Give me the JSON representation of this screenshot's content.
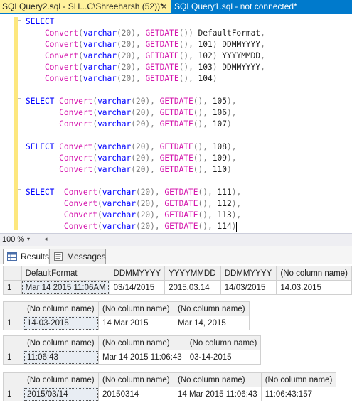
{
  "tabs": {
    "active_label": "SQLQuery2.sql - SH...C\\Shreeharsh (52))*",
    "close_glyph": "×",
    "inactive_label": "SQLQuery1.sql - not connected*"
  },
  "editor": {
    "lines": [
      [
        {
          "t": "SELECT",
          "c": "kw"
        }
      ],
      [
        {
          "t": "    ",
          "c": "bk"
        },
        {
          "t": "Convert",
          "c": "fn"
        },
        {
          "t": "(",
          "c": "gy"
        },
        {
          "t": "varchar",
          "c": "kw"
        },
        {
          "t": "(20), ",
          "c": "gy"
        },
        {
          "t": "GETDATE",
          "c": "fn"
        },
        {
          "t": "()) ",
          "c": "gy"
        },
        {
          "t": "DefaultFormat",
          "c": "bk"
        },
        {
          "t": ",",
          "c": "gy"
        }
      ],
      [
        {
          "t": "    ",
          "c": "bk"
        },
        {
          "t": "Convert",
          "c": "fn"
        },
        {
          "t": "(",
          "c": "gy"
        },
        {
          "t": "varchar",
          "c": "kw"
        },
        {
          "t": "(20), ",
          "c": "gy"
        },
        {
          "t": "GETDATE",
          "c": "fn"
        },
        {
          "t": "(), ",
          "c": "gy"
        },
        {
          "t": "101",
          "c": "bk"
        },
        {
          "t": ") ",
          "c": "gy"
        },
        {
          "t": "DDMMYYYY",
          "c": "bk"
        },
        {
          "t": ",",
          "c": "gy"
        }
      ],
      [
        {
          "t": "    ",
          "c": "bk"
        },
        {
          "t": "Convert",
          "c": "fn"
        },
        {
          "t": "(",
          "c": "gy"
        },
        {
          "t": "varchar",
          "c": "kw"
        },
        {
          "t": "(20), ",
          "c": "gy"
        },
        {
          "t": "GETDATE",
          "c": "fn"
        },
        {
          "t": "(), ",
          "c": "gy"
        },
        {
          "t": "102",
          "c": "bk"
        },
        {
          "t": ") ",
          "c": "gy"
        },
        {
          "t": "YYYYMMDD",
          "c": "bk"
        },
        {
          "t": ",",
          "c": "gy"
        }
      ],
      [
        {
          "t": "    ",
          "c": "bk"
        },
        {
          "t": "Convert",
          "c": "fn"
        },
        {
          "t": "(",
          "c": "gy"
        },
        {
          "t": "varchar",
          "c": "kw"
        },
        {
          "t": "(20), ",
          "c": "gy"
        },
        {
          "t": "GETDATE",
          "c": "fn"
        },
        {
          "t": "(), ",
          "c": "gy"
        },
        {
          "t": "103",
          "c": "bk"
        },
        {
          "t": ") ",
          "c": "gy"
        },
        {
          "t": "DDMMYYYY",
          "c": "bk"
        },
        {
          "t": ",",
          "c": "gy"
        }
      ],
      [
        {
          "t": "    ",
          "c": "bk"
        },
        {
          "t": "Convert",
          "c": "fn"
        },
        {
          "t": "(",
          "c": "gy"
        },
        {
          "t": "varchar",
          "c": "kw"
        },
        {
          "t": "(20), ",
          "c": "gy"
        },
        {
          "t": "GETDATE",
          "c": "fn"
        },
        {
          "t": "(), ",
          "c": "gy"
        },
        {
          "t": "104",
          "c": "bk"
        },
        {
          "t": ")",
          "c": "gy"
        }
      ],
      [],
      [
        {
          "t": "SELECT ",
          "c": "kw"
        },
        {
          "t": "Convert",
          "c": "fn"
        },
        {
          "t": "(",
          "c": "gy"
        },
        {
          "t": "varchar",
          "c": "kw"
        },
        {
          "t": "(20), ",
          "c": "gy"
        },
        {
          "t": "GETDATE",
          "c": "fn"
        },
        {
          "t": "(), ",
          "c": "gy"
        },
        {
          "t": "105",
          "c": "bk"
        },
        {
          "t": "),",
          "c": "gy"
        }
      ],
      [
        {
          "t": "       ",
          "c": "bk"
        },
        {
          "t": "Convert",
          "c": "fn"
        },
        {
          "t": "(",
          "c": "gy"
        },
        {
          "t": "varchar",
          "c": "kw"
        },
        {
          "t": "(20), ",
          "c": "gy"
        },
        {
          "t": "GETDATE",
          "c": "fn"
        },
        {
          "t": "(), ",
          "c": "gy"
        },
        {
          "t": "106",
          "c": "bk"
        },
        {
          "t": "),",
          "c": "gy"
        }
      ],
      [
        {
          "t": "       ",
          "c": "bk"
        },
        {
          "t": "Convert",
          "c": "fn"
        },
        {
          "t": "(",
          "c": "gy"
        },
        {
          "t": "varchar",
          "c": "kw"
        },
        {
          "t": "(20), ",
          "c": "gy"
        },
        {
          "t": "GETDATE",
          "c": "fn"
        },
        {
          "t": "(), ",
          "c": "gy"
        },
        {
          "t": "107",
          "c": "bk"
        },
        {
          "t": ")",
          "c": "gy"
        }
      ],
      [],
      [
        {
          "t": "SELECT ",
          "c": "kw"
        },
        {
          "t": "Convert",
          "c": "fn"
        },
        {
          "t": "(",
          "c": "gy"
        },
        {
          "t": "varchar",
          "c": "kw"
        },
        {
          "t": "(20), ",
          "c": "gy"
        },
        {
          "t": "GETDATE",
          "c": "fn"
        },
        {
          "t": "(), ",
          "c": "gy"
        },
        {
          "t": "108",
          "c": "bk"
        },
        {
          "t": "),",
          "c": "gy"
        }
      ],
      [
        {
          "t": "       ",
          "c": "bk"
        },
        {
          "t": "Convert",
          "c": "fn"
        },
        {
          "t": "(",
          "c": "gy"
        },
        {
          "t": "varchar",
          "c": "kw"
        },
        {
          "t": "(20), ",
          "c": "gy"
        },
        {
          "t": "GETDATE",
          "c": "fn"
        },
        {
          "t": "(), ",
          "c": "gy"
        },
        {
          "t": "109",
          "c": "bk"
        },
        {
          "t": "),",
          "c": "gy"
        }
      ],
      [
        {
          "t": "       ",
          "c": "bk"
        },
        {
          "t": "Convert",
          "c": "fn"
        },
        {
          "t": "(",
          "c": "gy"
        },
        {
          "t": "varchar",
          "c": "kw"
        },
        {
          "t": "(20), ",
          "c": "gy"
        },
        {
          "t": "GETDATE",
          "c": "fn"
        },
        {
          "t": "(), ",
          "c": "gy"
        },
        {
          "t": "110",
          "c": "bk"
        },
        {
          "t": ")",
          "c": "gy"
        }
      ],
      [],
      [
        {
          "t": "SELECT  ",
          "c": "kw"
        },
        {
          "t": "Convert",
          "c": "fn"
        },
        {
          "t": "(",
          "c": "gy"
        },
        {
          "t": "varchar",
          "c": "kw"
        },
        {
          "t": "(20), ",
          "c": "gy"
        },
        {
          "t": "GETDATE",
          "c": "fn"
        },
        {
          "t": "(), ",
          "c": "gy"
        },
        {
          "t": "111",
          "c": "bk"
        },
        {
          "t": "),",
          "c": "gy"
        }
      ],
      [
        {
          "t": "        ",
          "c": "bk"
        },
        {
          "t": "Convert",
          "c": "fn"
        },
        {
          "t": "(",
          "c": "gy"
        },
        {
          "t": "varchar",
          "c": "kw"
        },
        {
          "t": "(20), ",
          "c": "gy"
        },
        {
          "t": "GETDATE",
          "c": "fn"
        },
        {
          "t": "(), ",
          "c": "gy"
        },
        {
          "t": "112",
          "c": "bk"
        },
        {
          "t": "),",
          "c": "gy"
        }
      ],
      [
        {
          "t": "        ",
          "c": "bk"
        },
        {
          "t": "Convert",
          "c": "fn"
        },
        {
          "t": "(",
          "c": "gy"
        },
        {
          "t": "varchar",
          "c": "kw"
        },
        {
          "t": "(20), ",
          "c": "gy"
        },
        {
          "t": "GETDATE",
          "c": "fn"
        },
        {
          "t": "(), ",
          "c": "gy"
        },
        {
          "t": "113",
          "c": "bk"
        },
        {
          "t": "),",
          "c": "gy"
        }
      ],
      [
        {
          "t": "        ",
          "c": "bk"
        },
        {
          "t": "Convert",
          "c": "fn"
        },
        {
          "t": "(",
          "c": "gy"
        },
        {
          "t": "varchar",
          "c": "kw"
        },
        {
          "t": "(20), ",
          "c": "gy"
        },
        {
          "t": "GETDATE",
          "c": "fn"
        },
        {
          "t": "(), ",
          "c": "gy"
        },
        {
          "t": "114",
          "c": "bk"
        },
        {
          "t": ")",
          "c": "gy"
        }
      ]
    ]
  },
  "zoombar": {
    "zoom": "100 %",
    "caret": "▾",
    "scroll_left": "◂"
  },
  "results_tabs": {
    "results_label": "Results",
    "messages_label": "Messages"
  },
  "grids": [
    {
      "headers": [
        "DefaultFormat",
        "DDMMYYYY",
        "YYYYMMDD",
        "DDMMYYYY",
        "(No column name)"
      ],
      "rows": [
        [
          "1",
          "Mar 14 2015 11:06AM",
          "03/14/2015",
          "2015.03.14",
          "14/03/2015",
          "14.03.2015"
        ]
      ]
    },
    {
      "headers": [
        "(No column name)",
        "(No column name)",
        "(No column name)"
      ],
      "rows": [
        [
          "1",
          "14-03-2015",
          "14 Mar 2015",
          "Mar 14, 2015"
        ]
      ]
    },
    {
      "headers": [
        "(No column name)",
        "(No column name)",
        "(No column name)"
      ],
      "rows": [
        [
          "1",
          "11:06:43",
          "Mar 14 2015 11:06:43",
          "03-14-2015"
        ]
      ]
    },
    {
      "headers": [
        "(No column name)",
        "(No column name)",
        "(No column name)",
        "(No column name)"
      ],
      "rows": [
        [
          "1",
          "2015/03/14",
          "20150314",
          "14 Mar 2015 11:06:43",
          "11:06:43:157"
        ]
      ]
    }
  ],
  "colors": {
    "keyword": "#0000ff",
    "function": "#d417ad",
    "punctuation": "#7a7a7a",
    "active_tab": "#fff29d",
    "inactive_tab": "#007acc"
  }
}
